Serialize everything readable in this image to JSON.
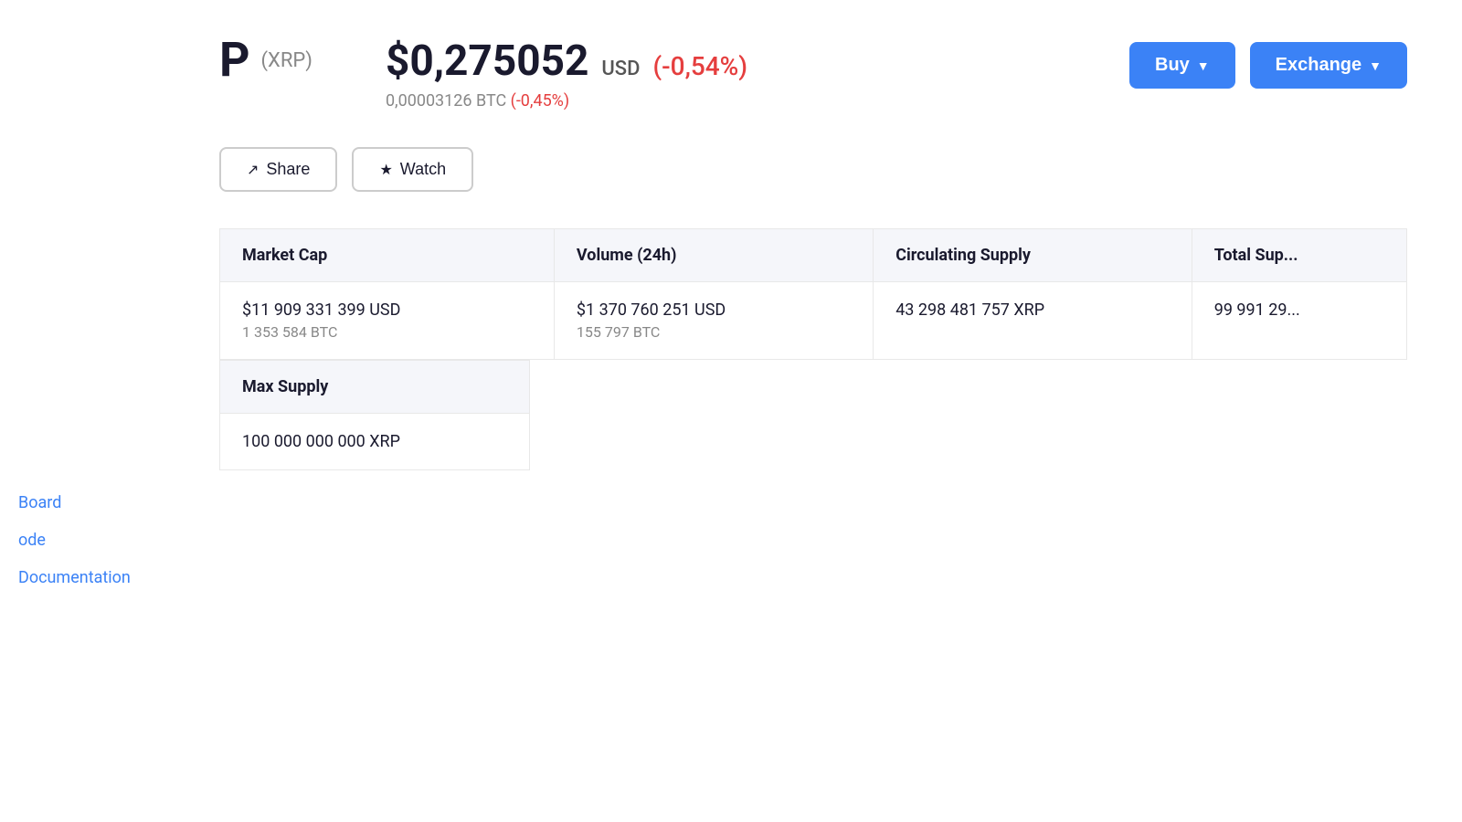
{
  "coin": {
    "symbol": "P",
    "ticker": "(XRP)",
    "name": "XRP"
  },
  "price": {
    "usd_value": "$0,275052",
    "currency_label": "USD",
    "change_24h": "(-0,54%)",
    "btc_value": "0,00003126 BTC",
    "btc_change": "(-0,45%)"
  },
  "buttons": {
    "buy_label": "Buy",
    "exchange_label": "Exchange",
    "share_label": "Share",
    "watch_label": "Watch"
  },
  "stats": {
    "headers": [
      "Market Cap",
      "Volume (24h)",
      "Circulating Supply",
      "Total Sup..."
    ],
    "rows": [
      {
        "market_cap_usd": "$11 909 331 399 USD",
        "market_cap_btc": "1 353 584 BTC",
        "volume_usd": "$1 370 760 251 USD",
        "volume_btc": "155 797 BTC",
        "circulating_supply": "43 298 481 757 XRP",
        "total_supply": "99 991 29..."
      }
    ]
  },
  "max_supply": {
    "header": "Max Supply",
    "value": "100 000 000 000 XRP"
  },
  "sidebar": {
    "links": [
      {
        "label": "Board",
        "name": "board-link"
      },
      {
        "label": "ode",
        "name": "code-link"
      },
      {
        "label": "Documentation",
        "name": "documentation-link"
      }
    ]
  }
}
